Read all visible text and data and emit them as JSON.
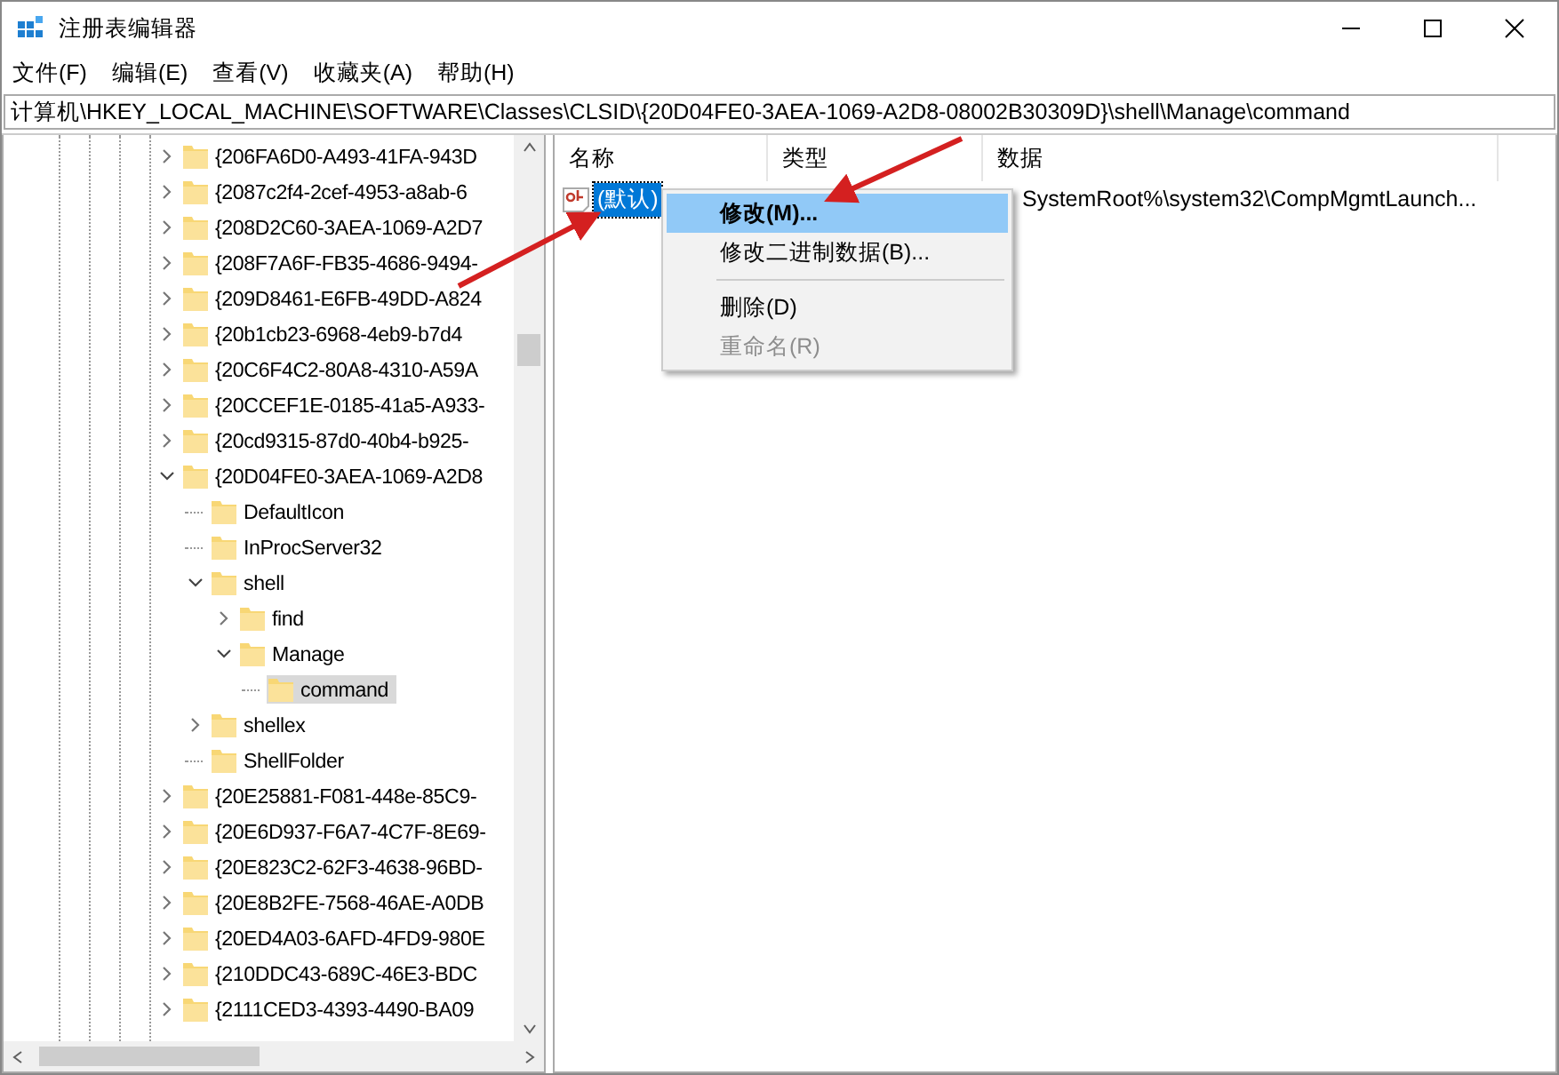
{
  "window": {
    "title": "注册表编辑器"
  },
  "menu": [
    {
      "label": "文件(F)"
    },
    {
      "label": "编辑(E)"
    },
    {
      "label": "查看(V)"
    },
    {
      "label": "收藏夹(A)"
    },
    {
      "label": "帮助(H)"
    }
  ],
  "address": "计算机\\HKEY_LOCAL_MACHINE\\SOFTWARE\\Classes\\CLSID\\{20D04FE0-3AEA-1069-A2D8-08002B30309D}\\shell\\Manage\\command",
  "tree": [
    {
      "label": "{206FA6D0-A493-41FA-943D",
      "expandable": true,
      "expanded": false,
      "selected": false
    },
    {
      "label": "{2087c2f4-2cef-4953-a8ab-6",
      "expandable": true,
      "expanded": false,
      "selected": false
    },
    {
      "label": "{208D2C60-3AEA-1069-A2D7",
      "expandable": true,
      "expanded": false,
      "selected": false
    },
    {
      "label": "{208F7A6F-FB35-4686-9494-",
      "expandable": true,
      "expanded": false,
      "selected": false
    },
    {
      "label": "{209D8461-E6FB-49DD-A824",
      "expandable": true,
      "expanded": false,
      "selected": false
    },
    {
      "label": "{20b1cb23-6968-4eb9-b7d4",
      "expandable": true,
      "expanded": false,
      "selected": false
    },
    {
      "label": "{20C6F4C2-80A8-4310-A59A",
      "expandable": true,
      "expanded": false,
      "selected": false
    },
    {
      "label": "{20CCEF1E-0185-41a5-A933-",
      "expandable": true,
      "expanded": false,
      "selected": false
    },
    {
      "label": "{20cd9315-87d0-40b4-b925-",
      "expandable": true,
      "expanded": false,
      "selected": false
    },
    {
      "label": "{20D04FE0-3AEA-1069-A2D8",
      "expandable": true,
      "expanded": true,
      "selected": false,
      "children": [
        {
          "label": "DefaultIcon",
          "expandable": false,
          "selected": false
        },
        {
          "label": "InProcServer32",
          "expandable": false,
          "selected": false
        },
        {
          "label": "shell",
          "expandable": true,
          "expanded": true,
          "selected": false,
          "children": [
            {
              "label": "find",
              "expandable": true,
              "expanded": false,
              "selected": false
            },
            {
              "label": "Manage",
              "expandable": true,
              "expanded": true,
              "selected": false,
              "children": [
                {
                  "label": "command",
                  "expandable": false,
                  "selected": true
                }
              ]
            }
          ]
        },
        {
          "label": "shellex",
          "expandable": true,
          "expanded": false,
          "selected": false
        },
        {
          "label": "ShellFolder",
          "expandable": false,
          "selected": false
        }
      ]
    },
    {
      "label": "{20E25881-F081-448e-85C9-",
      "expandable": true,
      "expanded": false,
      "selected": false
    },
    {
      "label": "{20E6D937-F6A7-4C7F-8E69-",
      "expandable": true,
      "expanded": false,
      "selected": false
    },
    {
      "label": "{20E823C2-62F3-4638-96BD-",
      "expandable": true,
      "expanded": false,
      "selected": false
    },
    {
      "label": "{20E8B2FE-7568-46AE-A0DB",
      "expandable": true,
      "expanded": false,
      "selected": false
    },
    {
      "label": "{20ED4A03-6AFD-4FD9-980E",
      "expandable": true,
      "expanded": false,
      "selected": false
    },
    {
      "label": "{210DDC43-689C-46E3-BDC",
      "expandable": true,
      "expanded": false,
      "selected": false
    },
    {
      "label": "{2111CED3-4393-4490-BA09",
      "expandable": true,
      "expanded": false,
      "selected": false
    }
  ],
  "values": {
    "columns": [
      {
        "label": "名称"
      },
      {
        "label": "类型"
      },
      {
        "label": "数据"
      }
    ],
    "rows": [
      {
        "name": "(默认)",
        "data": "SystemRoot%\\system32\\CompMgmtLaunch...",
        "selected": true
      }
    ]
  },
  "context_menu": [
    {
      "kind": "item",
      "label": "修改(M)...",
      "selected": true,
      "default": true,
      "disabled": false
    },
    {
      "kind": "item",
      "label": "修改二进制数据(B)...",
      "selected": false,
      "default": false,
      "disabled": false
    },
    {
      "kind": "separator"
    },
    {
      "kind": "item",
      "label": "删除(D)",
      "selected": false,
      "default": false,
      "disabled": false
    },
    {
      "kind": "item",
      "label": "重命名(R)",
      "selected": false,
      "default": false,
      "disabled": true
    }
  ]
}
